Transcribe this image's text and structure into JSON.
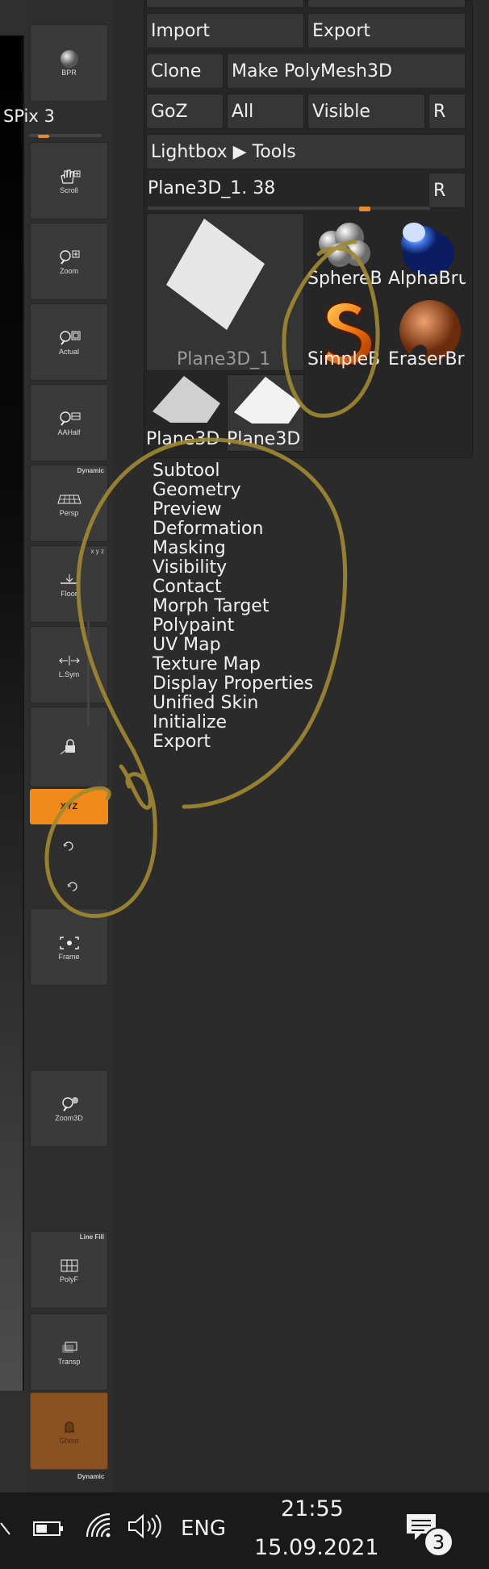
{
  "shelf": {
    "bpr_label": "BPR",
    "spix_label": "SPix 3",
    "spix_level": 0.15,
    "buttons": [
      {
        "label": "Scroll"
      },
      {
        "label": "Zoom"
      },
      {
        "label": "Actual"
      },
      {
        "label": "AAHalf"
      },
      {
        "label": "Persp",
        "tag": "Dynamic"
      },
      {
        "label": "Floor"
      },
      {
        "label": "L.Sym"
      },
      {
        "label": ""
      },
      {
        "label": "Frame"
      },
      {
        "label": "Zoom3D"
      },
      {
        "label": "PolyF",
        "tag": "Line Fill"
      },
      {
        "label": "Transp"
      },
      {
        "label": "Ghost",
        "tag": "Dynamic"
      }
    ],
    "xyz_label": "XYZ"
  },
  "palette": {
    "import_label": "Import",
    "export_label": "Export",
    "clone_label": "Clone",
    "make_polymesh_label": "Make PolyMesh3D",
    "goz_label": "GoZ",
    "all_label": "All",
    "visible_label": "Visible",
    "r_label": "R",
    "lightbox_label": "Lightbox ▶ Tools",
    "tool_name": "Plane3D_1. 38",
    "tool_slider_level": 0.78,
    "r2_label": "R",
    "thumbs": [
      {
        "label": "Plane3D_1"
      },
      {
        "label": "SphereB"
      },
      {
        "label": "AlphaBru"
      },
      {
        "label": "SimpleB"
      },
      {
        "label": "EraserBr"
      },
      {
        "label": "Plane3D"
      },
      {
        "label": "Plane3D"
      }
    ]
  },
  "menu": [
    "Subtool",
    "Geometry",
    "Preview",
    "Deformation",
    "Masking",
    "Visibility",
    "Contact",
    "Morph Target",
    "Polypaint",
    "UV Map",
    "Texture Map",
    "Display Properties",
    "Unified Skin",
    "Initialize",
    "Export"
  ],
  "taskbar": {
    "language": "ENG",
    "time": "21:55",
    "date": "15.09.2021",
    "notification_count": "3"
  },
  "colors": {
    "accent_orange": "#f08a1a",
    "annotation_yellow": "#a08a30",
    "panel_bg": "#262626"
  }
}
